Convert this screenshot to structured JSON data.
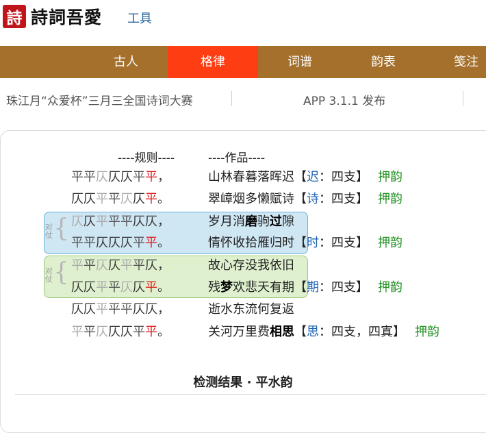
{
  "brand": {
    "logo_char": "詩",
    "name": "詩詞吾愛",
    "tools": "工具"
  },
  "nav": [
    {
      "label": "古人",
      "active": false
    },
    {
      "label": "格律",
      "active": true
    },
    {
      "label": "词谱",
      "active": false
    },
    {
      "label": "韵表",
      "active": false
    },
    {
      "label": "笺注",
      "active": false
    }
  ],
  "ticker": {
    "item1": "珠江月“众爱杯”三月三全国诗词大赛",
    "item2": "APP 3.1.1 发布"
  },
  "columns": {
    "rules": "----规则----",
    "work": "----作品----"
  },
  "duizhang_label": "对仗",
  "rows": [
    {
      "tones": [
        {
          "t": "平",
          "c": "p"
        },
        {
          "t": "平",
          "c": "p"
        },
        {
          "t": "仄",
          "c": "pl"
        },
        {
          "t": "仄",
          "c": "z"
        },
        {
          "t": "仄",
          "c": "z"
        },
        {
          "t": "平",
          "c": "p"
        },
        {
          "t": "平",
          "c": "rr"
        },
        {
          "t": "，",
          "c": "z"
        }
      ],
      "verse": [
        {
          "t": "山林春暮落晖迟"
        }
      ],
      "rhyme_char": "迟",
      "rhyme_info": "四支",
      "ya": "押韵"
    },
    {
      "tones": [
        {
          "t": "仄",
          "c": "z"
        },
        {
          "t": "仄",
          "c": "z"
        },
        {
          "t": "平",
          "c": "pl"
        },
        {
          "t": "平",
          "c": "p"
        },
        {
          "t": "仄",
          "c": "pl"
        },
        {
          "t": "仄",
          "c": "z"
        },
        {
          "t": "平",
          "c": "rr"
        },
        {
          "t": "。",
          "c": "z"
        }
      ],
      "verse": [
        {
          "t": "翠嶂烟多懒赋诗"
        }
      ],
      "rhyme_char": "诗",
      "rhyme_info": "四支",
      "ya": "押韵"
    },
    {
      "tones": [
        {
          "t": "仄",
          "c": "pl"
        },
        {
          "t": "仄",
          "c": "z"
        },
        {
          "t": "平",
          "c": "pl"
        },
        {
          "t": "平",
          "c": "p"
        },
        {
          "t": "平",
          "c": "p"
        },
        {
          "t": "仄",
          "c": "z"
        },
        {
          "t": "仄",
          "c": "z"
        },
        {
          "t": "，",
          "c": "z"
        }
      ],
      "verse": [
        {
          "t": "岁月消"
        },
        {
          "t": "磨",
          "b": true
        },
        {
          "t": "驹"
        },
        {
          "t": "过",
          "b": true
        },
        {
          "t": "隙"
        }
      ],
      "rhyme_char": "",
      "rhyme_info": "",
      "ya": ""
    },
    {
      "tones": [
        {
          "t": "平",
          "c": "p"
        },
        {
          "t": "平",
          "c": "p"
        },
        {
          "t": "仄",
          "c": "z"
        },
        {
          "t": "仄",
          "c": "z"
        },
        {
          "t": "仄",
          "c": "z"
        },
        {
          "t": "平",
          "c": "p"
        },
        {
          "t": "平",
          "c": "rr"
        },
        {
          "t": "。",
          "c": "z"
        }
      ],
      "verse": [
        {
          "t": "情怀收拾雁归时"
        }
      ],
      "rhyme_char": "时",
      "rhyme_info": "四支",
      "ya": "押韵"
    },
    {
      "tones": [
        {
          "t": "平",
          "c": "pl"
        },
        {
          "t": "平",
          "c": "p"
        },
        {
          "t": "仄",
          "c": "pl"
        },
        {
          "t": "仄",
          "c": "z"
        },
        {
          "t": "平",
          "c": "pl"
        },
        {
          "t": "平",
          "c": "p"
        },
        {
          "t": "仄",
          "c": "z"
        },
        {
          "t": "，",
          "c": "z"
        }
      ],
      "verse": [
        {
          "t": "故心存没我依旧"
        }
      ],
      "rhyme_char": "",
      "rhyme_info": "",
      "ya": ""
    },
    {
      "tones": [
        {
          "t": "仄",
          "c": "z"
        },
        {
          "t": "仄",
          "c": "z"
        },
        {
          "t": "平",
          "c": "pl"
        },
        {
          "t": "平",
          "c": "p"
        },
        {
          "t": "仄",
          "c": "pl"
        },
        {
          "t": "仄",
          "c": "z"
        },
        {
          "t": "平",
          "c": "rr"
        },
        {
          "t": "。",
          "c": "z"
        }
      ],
      "verse": [
        {
          "t": "残"
        },
        {
          "t": "梦",
          "b": true
        },
        {
          "t": "欢悲天有期"
        }
      ],
      "rhyme_char": "期",
      "rhyme_info": "四支",
      "ya": "押韵"
    },
    {
      "tones": [
        {
          "t": "仄",
          "c": "z"
        },
        {
          "t": "仄",
          "c": "z"
        },
        {
          "t": "平",
          "c": "pl"
        },
        {
          "t": "平",
          "c": "p"
        },
        {
          "t": "平",
          "c": "p"
        },
        {
          "t": "仄",
          "c": "z"
        },
        {
          "t": "仄",
          "c": "z"
        },
        {
          "t": "，",
          "c": "z"
        }
      ],
      "verse": [
        {
          "t": "逝水东流何复返"
        }
      ],
      "rhyme_char": "",
      "rhyme_info": "",
      "ya": ""
    },
    {
      "tones": [
        {
          "t": "平",
          "c": "pl"
        },
        {
          "t": "平",
          "c": "p"
        },
        {
          "t": "仄",
          "c": "pl"
        },
        {
          "t": "仄",
          "c": "z"
        },
        {
          "t": "仄",
          "c": "z"
        },
        {
          "t": "平",
          "c": "p"
        },
        {
          "t": "平",
          "c": "rr"
        },
        {
          "t": "。",
          "c": "z"
        }
      ],
      "verse": [
        {
          "t": "关河万里费"
        },
        {
          "t": "相思",
          "b": true
        }
      ],
      "rhyme_char": "思",
      "rhyme_info": "四支，四寘",
      "ya": "押韵"
    }
  ],
  "result_title": "检测结果 · 平水韵"
}
